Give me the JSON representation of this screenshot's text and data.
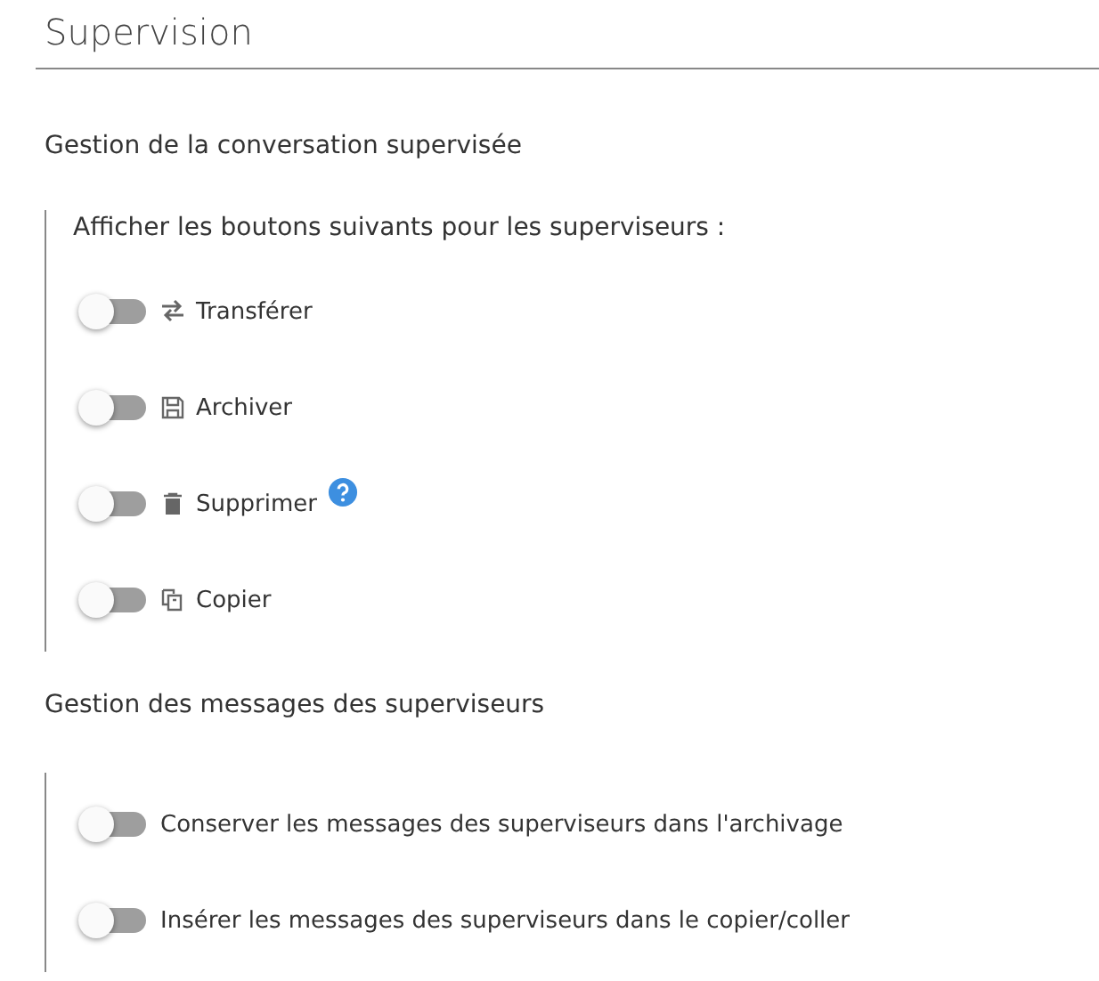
{
  "title": "Supervision",
  "sections": [
    {
      "heading": "Gestion de la conversation supervisée",
      "intro": "Afficher les boutons suivants pour les superviseurs :",
      "options": [
        {
          "label": "Transférer",
          "kind": "transfer",
          "on": false,
          "help": false
        },
        {
          "label": "Archiver",
          "kind": "save",
          "on": false,
          "help": false
        },
        {
          "label": "Supprimer",
          "kind": "trash",
          "on": false,
          "help": true
        },
        {
          "label": "Copier",
          "kind": "copy",
          "on": false,
          "help": false
        }
      ]
    },
    {
      "heading": "Gestion des messages des superviseurs",
      "options": [
        {
          "label": "Conserver les messages des superviseurs dans l'archivage",
          "on": false,
          "help": false
        },
        {
          "label": "Insérer les messages des superviseurs dans le copier/coller",
          "on": false,
          "help": false
        }
      ]
    }
  ]
}
